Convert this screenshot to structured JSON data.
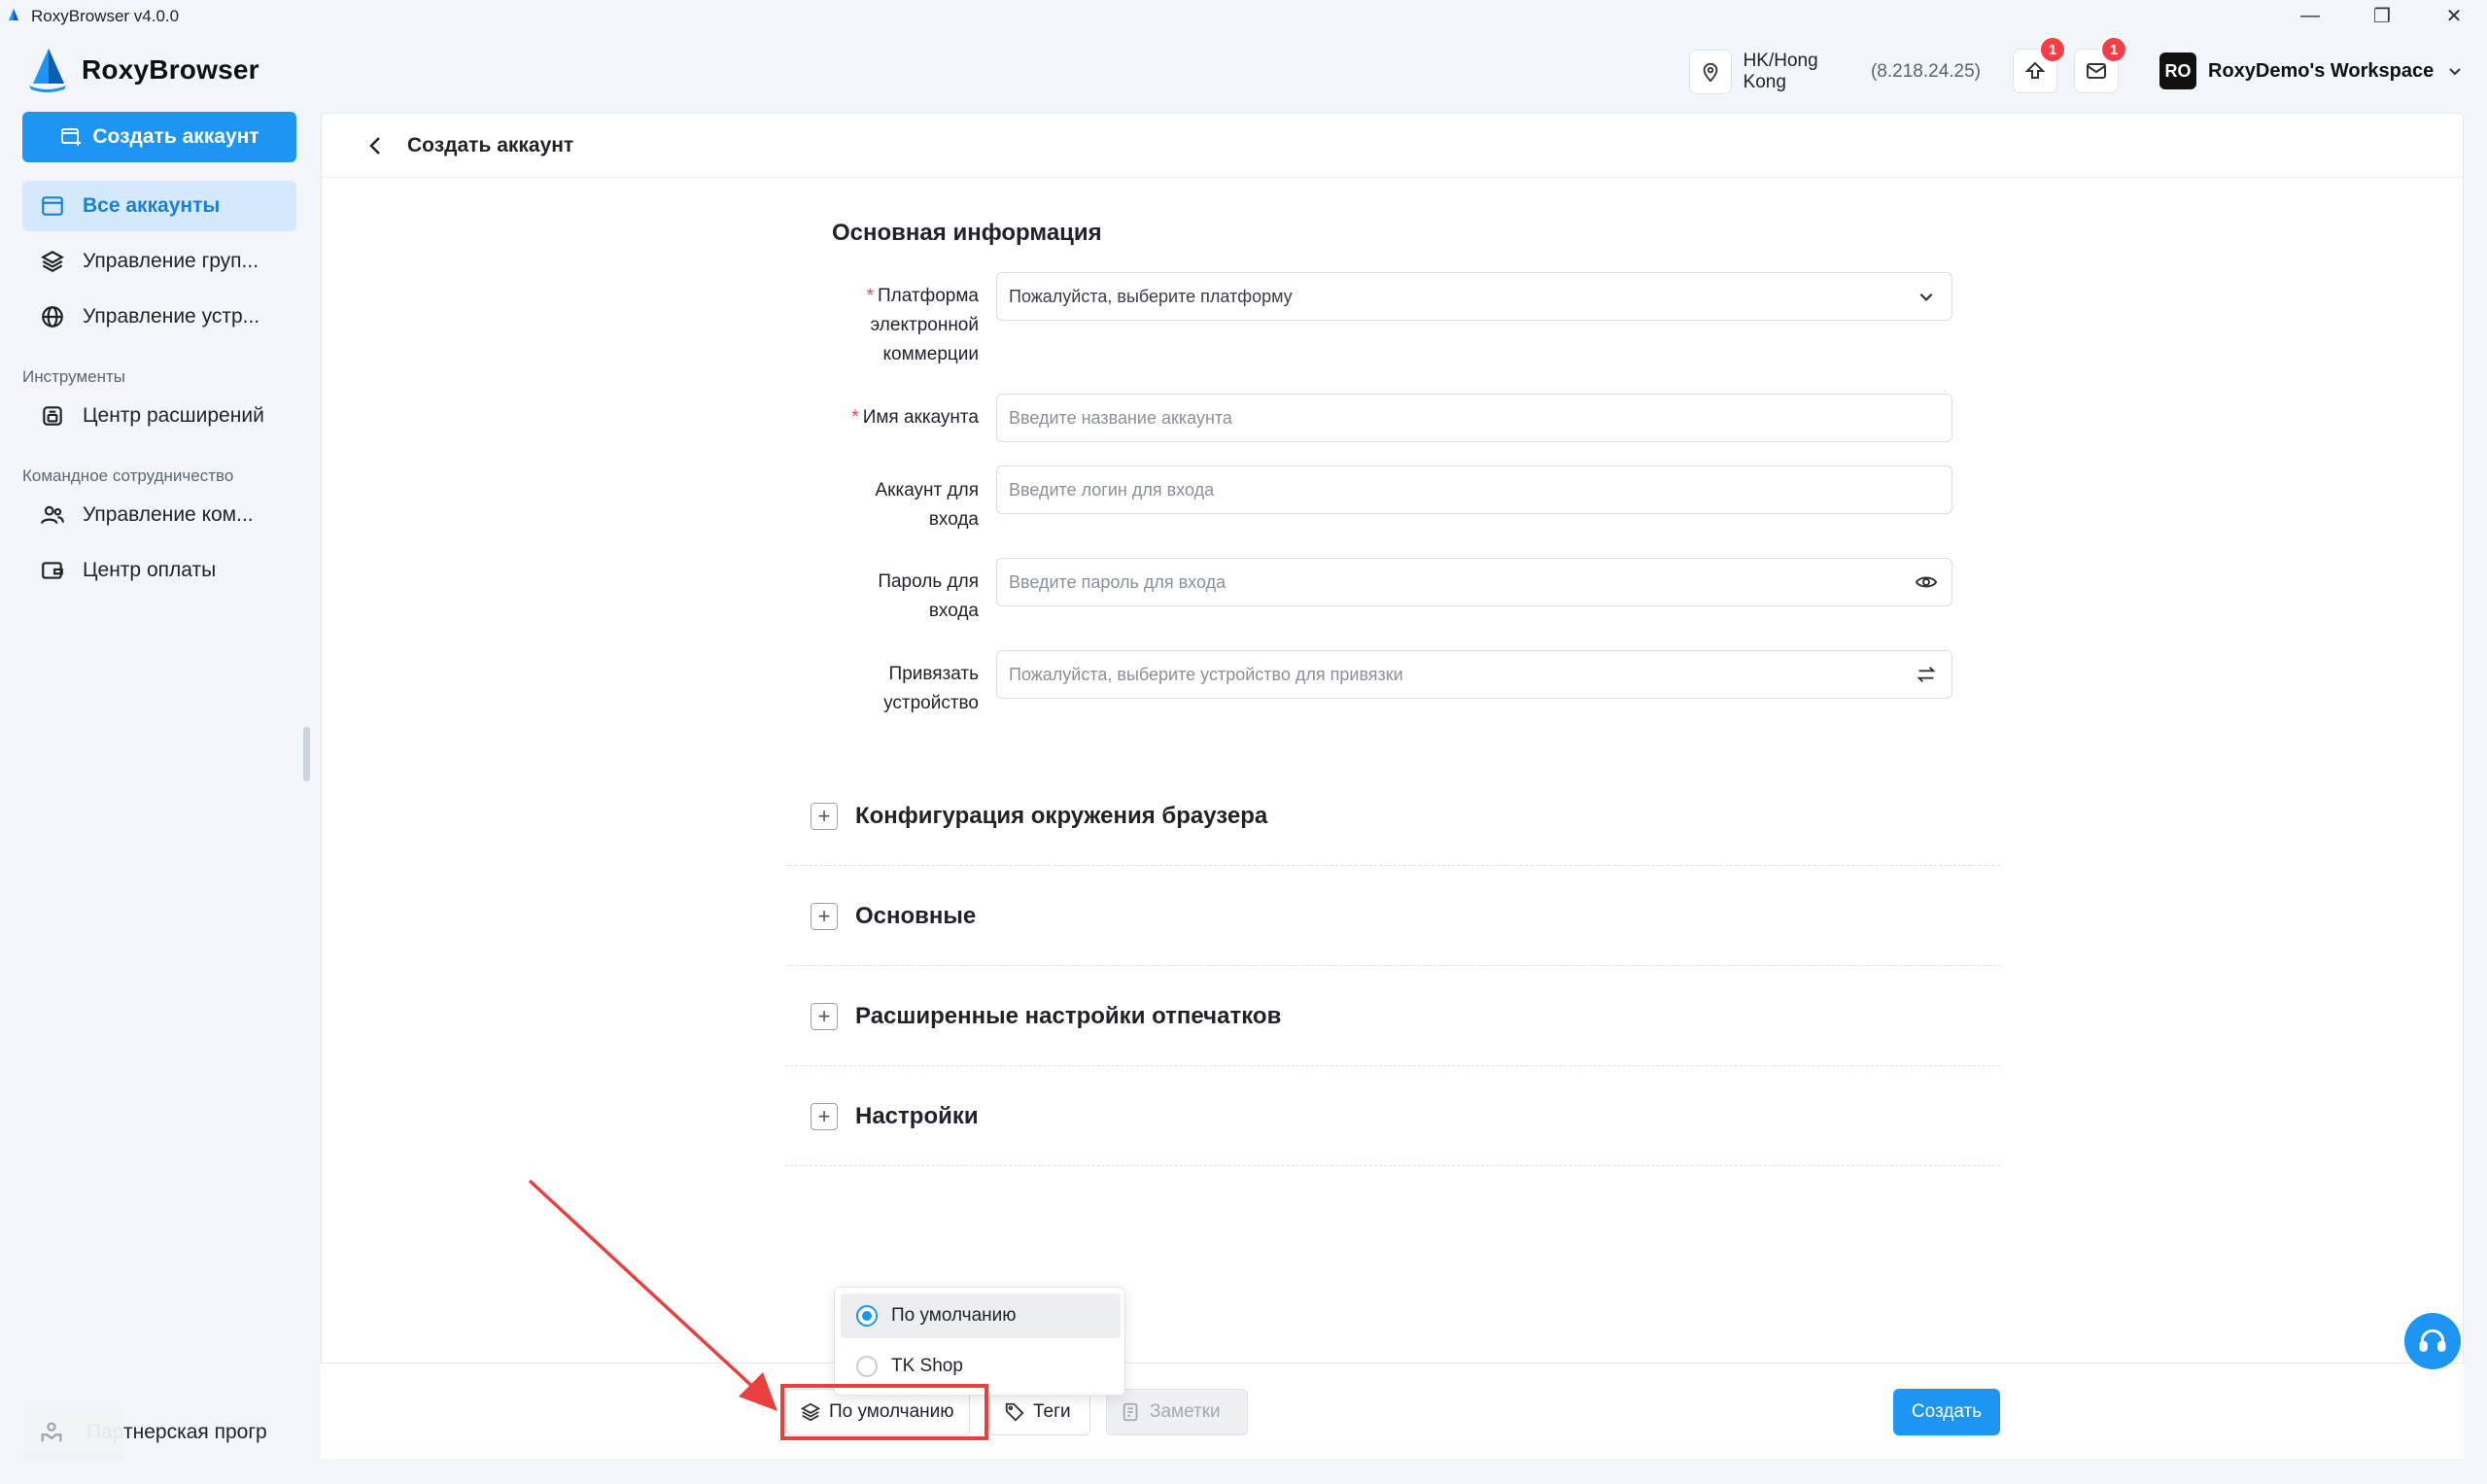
{
  "window": {
    "title": "RoxyBrowser v4.0.0",
    "controls": {
      "minimize": "—",
      "maximize": "❐",
      "close": "✕"
    }
  },
  "header": {
    "brand": "RoxyBrowser",
    "location": "HK/Hong Kong",
    "ip": "(8.218.24.25)",
    "upgrade_badge": "1",
    "mail_badge": "1",
    "workspace_initials": "RO",
    "workspace_name": "RoxyDemo's Workspace"
  },
  "sidebar": {
    "create_label": "Создать аккаунт",
    "items": [
      {
        "label": "Все аккаунты",
        "icon": "browser-window-icon",
        "active": true
      },
      {
        "label": "Управление груп...",
        "icon": "layers-icon"
      },
      {
        "label": "Управление устр...",
        "icon": "globe-icon"
      }
    ],
    "tools_section": "Инструменты",
    "tools_items": [
      {
        "label": "Центр расширений",
        "icon": "extension-icon"
      }
    ],
    "team_section": "Командное сотрудничество",
    "team_items": [
      {
        "label": "Управление ком...",
        "icon": "users-icon"
      },
      {
        "label": "Центр оплаты",
        "icon": "wallet-icon"
      }
    ],
    "partner_label": "Партнерская прогр"
  },
  "main": {
    "page_title": "Создать аккаунт",
    "section_title": "Основная информация",
    "fields": {
      "platform": {
        "label": "Платформа электронной коммерции",
        "placeholder": "Пожалуйста, выберите платформу"
      },
      "account_name": {
        "label": "Имя аккаунта",
        "placeholder": "Введите название аккаунта"
      },
      "login": {
        "label": "Аккаунт для входа",
        "placeholder": "Введите логин для входа"
      },
      "password": {
        "label": "Пароль для входа",
        "placeholder": "Введите пароль для входа"
      },
      "device": {
        "label": "Привязать устройство",
        "placeholder": "Пожалуйста, выберите устройство для привязки"
      }
    },
    "accordions": [
      "Конфигурация окружения браузера",
      "Основные",
      "Расширенные настройки отпечатков",
      "Настройки"
    ]
  },
  "footer": {
    "group_label": "По умолчанию",
    "tags_label": "Теги",
    "notes_label": "Заметки",
    "create_label": "Создать"
  },
  "dropdown": {
    "options": [
      {
        "label": "По умолчанию",
        "selected": true
      },
      {
        "label": "TK Shop",
        "selected": false
      }
    ]
  },
  "colors": {
    "accent": "#1d96f3",
    "badge": "#f43f46",
    "annotation": "#e8403f"
  }
}
